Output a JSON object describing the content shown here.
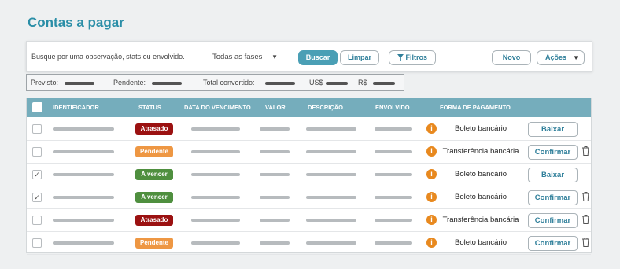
{
  "page": {
    "title": "Contas a pagar"
  },
  "toolbar": {
    "search_placeholder": "Busque por uma observação, stats ou envolvido.",
    "phase_value": "Todas as fases",
    "buscar": "Buscar",
    "limpar": "Limpar",
    "filtros": "Filtros",
    "novo": "Novo",
    "acoes": "Ações"
  },
  "summary": {
    "previsto": "Previsto:",
    "pendente": "Pendente:",
    "total": "Total convertido:",
    "usd": "US$",
    "brl": "R$"
  },
  "table": {
    "headers": {
      "identificador": "IDENTIFICADOR",
      "status": "STATUS",
      "vencimento": "DATA DO VENCIMENTO",
      "valor": "VALOR",
      "descricao": "DESCRIÇÃO",
      "envolvido": "ENVOLVIDO",
      "pagamento": "FORMA DE PAGAMENTO"
    },
    "rows": [
      {
        "checked": false,
        "status": "Atrasado",
        "payment": "Boleto bancário",
        "action": "Baixar",
        "trash": false
      },
      {
        "checked": false,
        "status": "Pendente",
        "payment": "Transferência bancária",
        "action": "Confirmar",
        "trash": true
      },
      {
        "checked": true,
        "status": "A vencer",
        "payment": "Boleto bancário",
        "action": "Baixar",
        "trash": false
      },
      {
        "checked": true,
        "status": "A vencer",
        "payment": "Boleto bancário",
        "action": "Confirmar",
        "trash": true
      },
      {
        "checked": false,
        "status": "Atrasado",
        "payment": "Transferência bancária",
        "action": "Confirmar",
        "trash": true
      },
      {
        "checked": false,
        "status": "Pendente",
        "payment": "Boleto bancário",
        "action": "Confirmar",
        "trash": true
      }
    ]
  },
  "colors": {
    "accent": "#2a8ea7",
    "header": "#75adbc",
    "Atrasado": "#9b1111",
    "Pendente": "#ee9743",
    "A vencer": "#4f8f3f",
    "info": "#e8891f"
  }
}
